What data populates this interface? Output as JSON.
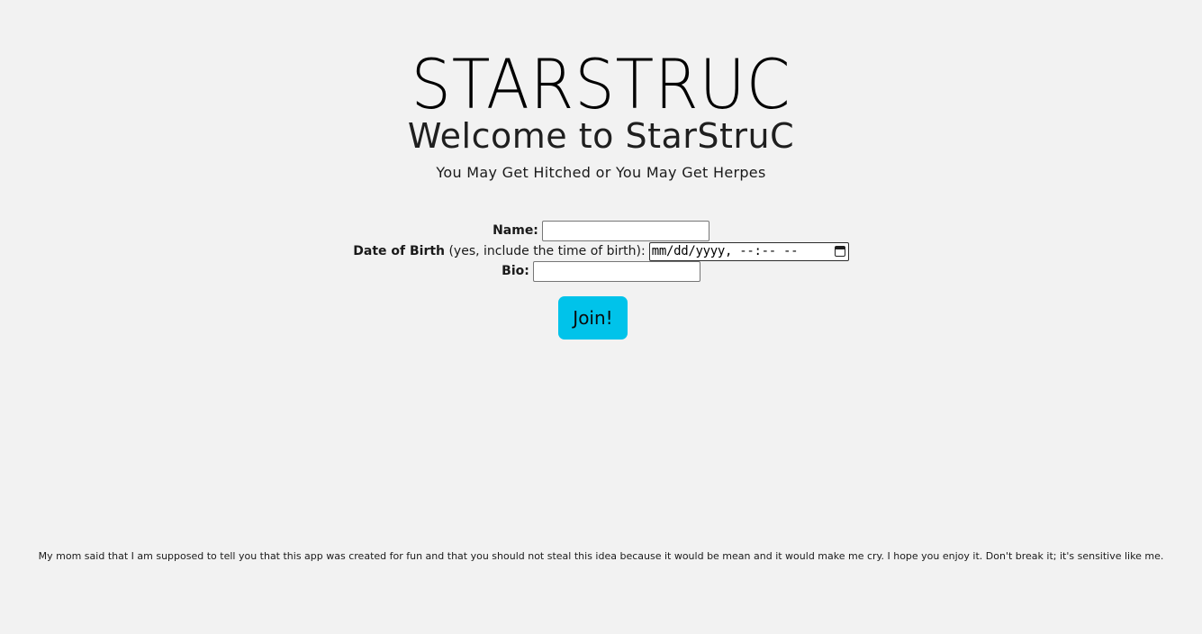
{
  "header": {
    "logo_text": "STARSTRUC",
    "welcome": "Welcome to StarStruC",
    "tagline": "You May Get Hitched or You May Get Herpes"
  },
  "form": {
    "name_label": "Name:",
    "name_value": "",
    "dob_label_bold": "Date of Birth",
    "dob_label_rest": " (yes, include the time of birth):",
    "dob_placeholder": "mm/dd/yyyy, --:-- --",
    "bio_label": "Bio:",
    "bio_value": "",
    "submit_label": "Join!"
  },
  "footer": {
    "disclaimer": "My mom said that I am supposed to tell you that this app was created for fun and that you should not steal this idea because it would be mean and it would make me cry. I hope you enjoy it. Don't break it; it's sensitive like me."
  },
  "colors": {
    "background": "#f2f2f2",
    "button": "#00c3ea"
  },
  "icons": {
    "dob_picker": "calendar-icon"
  }
}
